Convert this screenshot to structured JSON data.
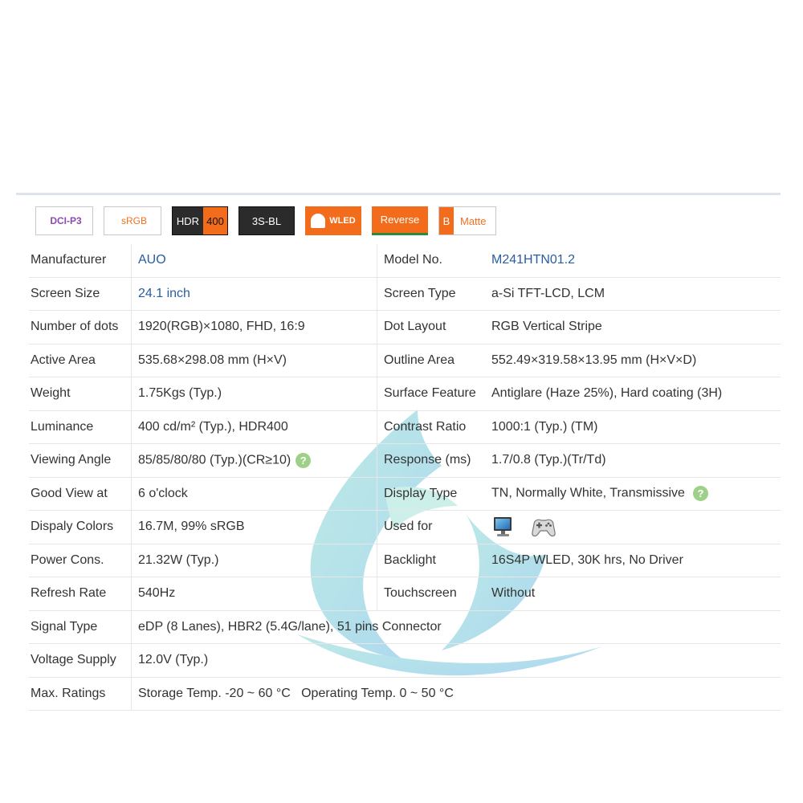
{
  "badges": {
    "dci": "DCI-P3",
    "srgb": "sRGB",
    "hdr_a": "HDR",
    "hdr_b": "400",
    "bl": "3S-BL",
    "wled": "WLED",
    "reverse": "Reverse",
    "matte_a": "B",
    "matte_b": "Matte"
  },
  "help_glyph": "?",
  "rows": [
    {
      "l1": "Manufacturer",
      "v1": "AUO",
      "l2": "Model No.",
      "v2": "M241HTN01.2"
    },
    {
      "l1": "Screen Size",
      "v1": "24.1 inch",
      "l2": "Screen Type",
      "v2": "a-Si TFT-LCD, LCM"
    },
    {
      "l1": "Number of dots",
      "v1": "1920(RGB)×1080, FHD, 16:9",
      "l2": "Dot Layout",
      "v2": "RGB Vertical Stripe"
    },
    {
      "l1": "Active Area",
      "v1": "535.68×298.08 mm (H×V)",
      "l2": "Outline Area",
      "v2": "552.49×319.58×13.95 mm (H×V×D)"
    },
    {
      "l1": "Weight",
      "v1": "1.75Kgs (Typ.)",
      "l2": "Surface Feature",
      "v2": "Antiglare (Haze 25%), Hard coating (3H)"
    },
    {
      "l1": "Luminance",
      "v1": "400 cd/m² (Typ.), HDR400",
      "l2": "Contrast Ratio",
      "v2": "1000:1 (Typ.) (TM)"
    },
    {
      "l1": "Viewing Angle",
      "v1": "85/85/80/80 (Typ.)(CR≥10)",
      "l2": "Response (ms)",
      "v2": "1.7/0.8 (Typ.)(Tr/Td)"
    },
    {
      "l1": "Good View at",
      "v1": "6 o'clock",
      "l2": "Display Type",
      "v2": "TN, Normally White, Transmissive"
    },
    {
      "l1": "Dispaly Colors",
      "v1": "16.7M, 99% sRGB",
      "l2": "Used for",
      "v2": ""
    },
    {
      "l1": "Power Cons.",
      "v1": "21.32W (Typ.)",
      "l2": "Backlight",
      "v2": "16S4P WLED, 30K hrs, No Driver"
    },
    {
      "l1": "Refresh Rate",
      "v1": "540Hz",
      "l2": "Touchscreen",
      "v2": "Without"
    },
    {
      "l1": "Signal Type",
      "v1": "eDP (8 Lanes), HBR2 (5.4G/lane), 51 pins Connector"
    },
    {
      "l1": "Voltage Supply",
      "v1": "12.0V (Typ.)"
    },
    {
      "l1": "Max. Ratings",
      "v1": "Storage Temp. -20 ~ 60 °C   Operating Temp. 0 ~ 50 °C"
    }
  ],
  "used_for_icons": [
    "monitor-icon",
    "gamepad-icon"
  ],
  "colors": {
    "link": "#2a5d9f",
    "orange": "#f26c1c",
    "help": "#9fd08a"
  }
}
